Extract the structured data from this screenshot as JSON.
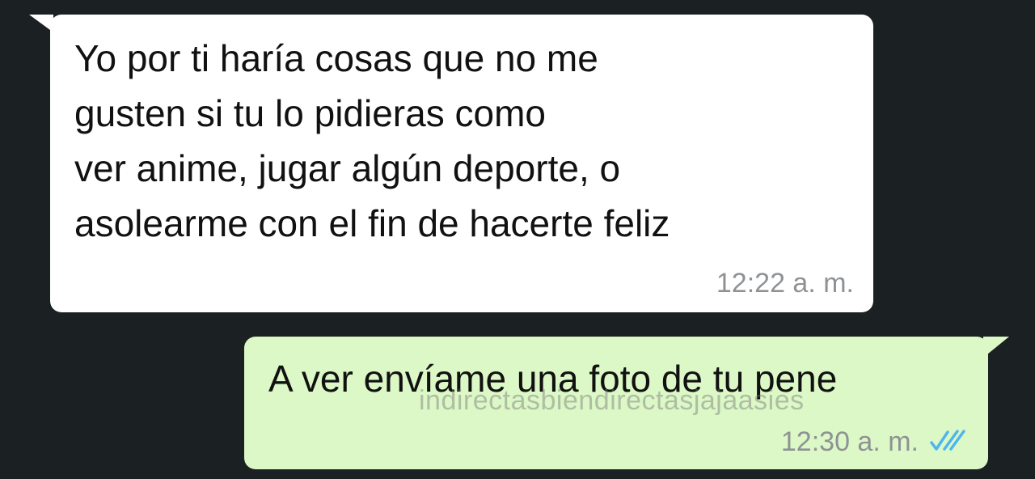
{
  "chat": {
    "incoming": {
      "text": "Yo por ti haría cosas que no me\ngusten si tu lo pidieras como\nver anime, jugar algún deporte, o\nasolearme con el fin de hacerte feliz",
      "time": "12:22 a. m."
    },
    "outgoing": {
      "text": "A ver envíame una foto de tu pene",
      "time": "12:30 a. m.",
      "status_icon": "double-check-read-icon"
    },
    "watermark": "indirectasbiendirectasjajaasies"
  },
  "colors": {
    "background": "#1b2123",
    "incoming_bubble": "#ffffff",
    "outgoing_bubble": "#dcf8c6",
    "read_ticks": "#4fb6ec",
    "timestamp": "#8f9295"
  }
}
